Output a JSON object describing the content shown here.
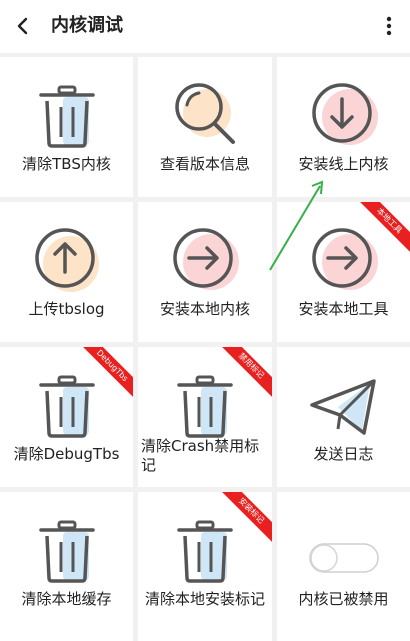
{
  "header": {
    "title": "内核调试",
    "back_icon": "chevron-left-icon",
    "more_icon": "more-vertical-icon"
  },
  "tiles": [
    {
      "label": "清除TBS内核",
      "icon": "trash-icon",
      "ribbon": ""
    },
    {
      "label": "查看版本信息",
      "icon": "search-icon",
      "ribbon": ""
    },
    {
      "label": "安装线上内核",
      "icon": "download-circle-icon",
      "ribbon": ""
    },
    {
      "label": "上传tbslog",
      "icon": "upload-circle-icon",
      "ribbon": ""
    },
    {
      "label": "安装本地内核",
      "icon": "arrow-right-circle-icon",
      "ribbon": ""
    },
    {
      "label": "安装本地工具",
      "icon": "arrow-right-circle-icon",
      "ribbon": "本地工具"
    },
    {
      "label": "清除DebugTbs",
      "icon": "trash-icon",
      "ribbon": "DebugTbs"
    },
    {
      "label": "清除Crash禁用标记",
      "icon": "trash-icon",
      "ribbon": "禁用标记"
    },
    {
      "label": "发送日志",
      "icon": "send-icon",
      "ribbon": ""
    },
    {
      "label": "清除本地缓存",
      "icon": "trash-icon",
      "ribbon": ""
    },
    {
      "label": "清除本地安装标记",
      "icon": "trash-icon",
      "ribbon": "安装标记"
    },
    {
      "label": "内核已被禁用",
      "icon": "toggle-switch-icon",
      "ribbon": ""
    }
  ],
  "colors": {
    "accent_blue": "#cfe6f7",
    "accent_orange": "#fde3c8",
    "accent_pink": "#fbd5d5",
    "stroke": "#555555",
    "ribbon": "#e8201f",
    "annotation_arrow": "#35b04a"
  },
  "toggle": {
    "enabled": false
  }
}
